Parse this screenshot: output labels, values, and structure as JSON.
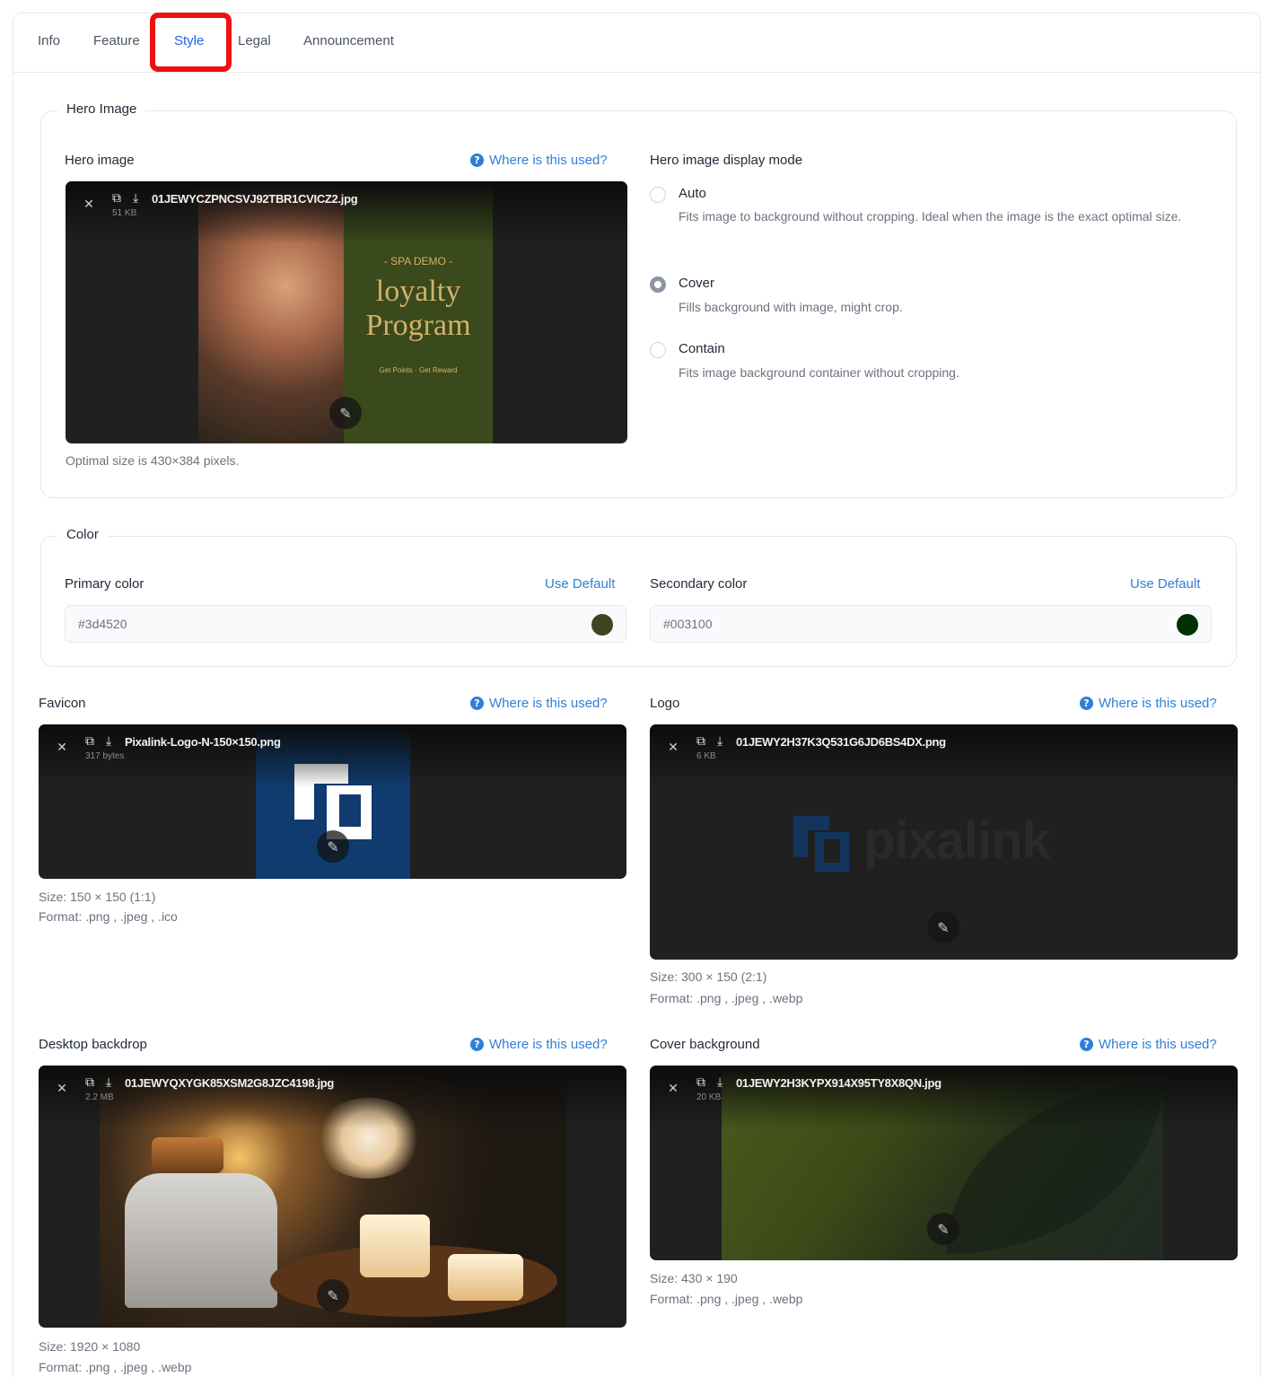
{
  "tabs": [
    {
      "label": "Info",
      "active": false
    },
    {
      "label": "Feature",
      "active": false
    },
    {
      "label": "Style",
      "active": true
    },
    {
      "label": "Legal",
      "active": false
    },
    {
      "label": "Announcement",
      "active": false
    }
  ],
  "hero_section": {
    "legend": "Hero Image",
    "image_label": "Hero image",
    "where_used": "Where is this used?",
    "file_name": "01JEWYCZPNCSVJ92TBR1CVICZ2.jpg",
    "file_size": "51 KB",
    "image_text": {
      "demo": "- SPA DEMO -",
      "line1": "loyalty",
      "line2": "Program",
      "tagline": "Get Points · Get Reward"
    },
    "optimal_size": "Optimal size is 430×384 pixels.",
    "display_mode_label": "Hero image display mode",
    "modes": [
      {
        "title": "Auto",
        "desc": "Fits image to background without cropping. Ideal when the image is the exact optimal size.",
        "checked": false
      },
      {
        "title": "Cover",
        "desc": "Fills background with image, might crop.",
        "checked": true
      },
      {
        "title": "Contain",
        "desc": "Fits image background container without cropping.",
        "checked": false
      }
    ]
  },
  "color_section": {
    "legend": "Color",
    "primary_label": "Primary color",
    "primary_use_default": "Use Default",
    "primary_value": "#3d4520",
    "secondary_label": "Secondary color",
    "secondary_use_default": "Use Default",
    "secondary_value": "#003100"
  },
  "favicon": {
    "label": "Favicon",
    "where_used": "Where is this used?",
    "file_name": "Pixalink-Logo-N-150×150.png",
    "file_size": "317 bytes",
    "size": "Size: 150 × 150 (1:1)",
    "format": "Format: .png , .jpeg , .ico"
  },
  "logo": {
    "label": "Logo",
    "where_used": "Where is this used?",
    "file_name": "01JEWY2H37K3Q531G6JD6BS4DX.png",
    "file_size": "6 KB",
    "logo_text": "pixalink",
    "size": "Size: 300 × 150 (2:1)",
    "format": "Format: .png , .jpeg , .webp"
  },
  "desktop_backdrop": {
    "label": "Desktop backdrop",
    "where_used": "Where is this used?",
    "file_name": "01JEWYQXYGK85XSM2G8JZC4198.jpg",
    "file_size": "2.2 MB",
    "size": "Size: 1920 × 1080",
    "format": "Format: .png , .jpeg , .webp"
  },
  "cover_background": {
    "label": "Cover background",
    "where_used": "Where is this used?",
    "file_name": "01JEWY2H3KYPX914X95TY8X8QN.jpg",
    "file_size": "20 KB",
    "size": "Size: 430 × 190",
    "format": "Format: .png , .jpeg , .webp"
  },
  "colors": {
    "accent": "#2563eb",
    "link": "#2f7fd6",
    "highlight": "#ee1111",
    "favicon_bg": "#0f3b6e",
    "hero_panel": "#3a4a1c"
  }
}
